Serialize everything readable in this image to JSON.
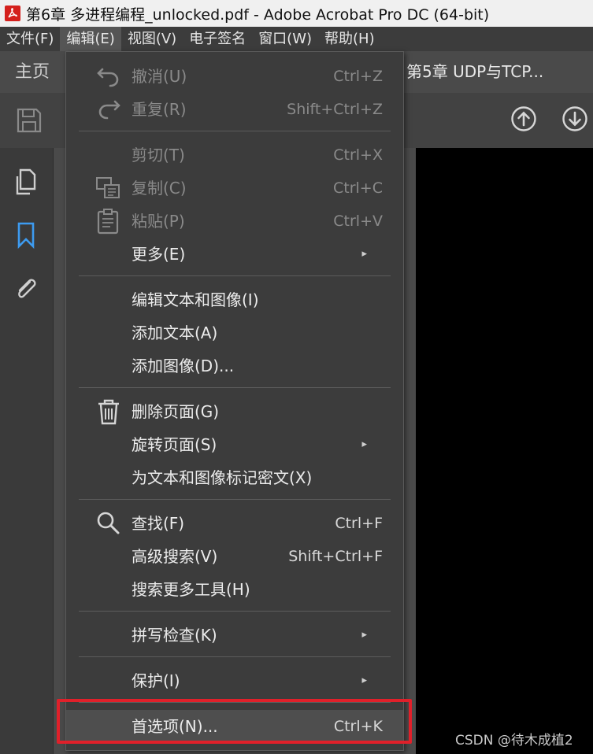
{
  "window": {
    "title": "第6章 多进程编程_unlocked.pdf - Adobe Acrobat Pro DC (64-bit)"
  },
  "menubar": [
    {
      "label": "文件(F)"
    },
    {
      "label": "编辑(E)"
    },
    {
      "label": "视图(V)"
    },
    {
      "label": "电子签名"
    },
    {
      "label": "窗口(W)"
    },
    {
      "label": "帮助(H)"
    }
  ],
  "tabs": {
    "home": "主页",
    "doc": "第5章 UDP与TCP..."
  },
  "edit_menu": {
    "items": [
      {
        "label": "撤消(U)",
        "shortcut": "Ctrl+Z",
        "icon": "undo-icon",
        "enabled": false
      },
      {
        "label": "重复(R)",
        "shortcut": "Shift+Ctrl+Z",
        "icon": "redo-icon",
        "enabled": false
      },
      {
        "label": "剪切(T)",
        "shortcut": "Ctrl+X",
        "enabled": false
      },
      {
        "label": "复制(C)",
        "shortcut": "Ctrl+C",
        "icon": "copy-icon",
        "enabled": false
      },
      {
        "label": "粘贴(P)",
        "shortcut": "Ctrl+V",
        "icon": "paste-icon",
        "enabled": false
      },
      {
        "label": "更多(E)",
        "submenu": true
      },
      {
        "label": "编辑文本和图像(I)"
      },
      {
        "label": "添加文本(A)"
      },
      {
        "label": "添加图像(D)..."
      },
      {
        "label": "删除页面(G)",
        "icon": "trash-icon"
      },
      {
        "label": "旋转页面(S)",
        "submenu": true
      },
      {
        "label": "为文本和图像标记密文(X)"
      },
      {
        "label": "查找(F)",
        "shortcut": "Ctrl+F",
        "icon": "search-icon"
      },
      {
        "label": "高级搜索(V)",
        "shortcut": "Shift+Ctrl+F"
      },
      {
        "label": "搜索更多工具(H)"
      },
      {
        "label": "拼写检查(K)",
        "submenu": true
      },
      {
        "label": "保护(I)",
        "submenu": true
      },
      {
        "label": "首选项(N)...",
        "shortcut": "Ctrl+K",
        "highlighted": true
      }
    ],
    "submenu_arrow": "▸"
  },
  "watermark": "CSDN @待木成植2",
  "colors": {
    "highlight": "#e0202a",
    "accent": "#3d9bf0"
  }
}
